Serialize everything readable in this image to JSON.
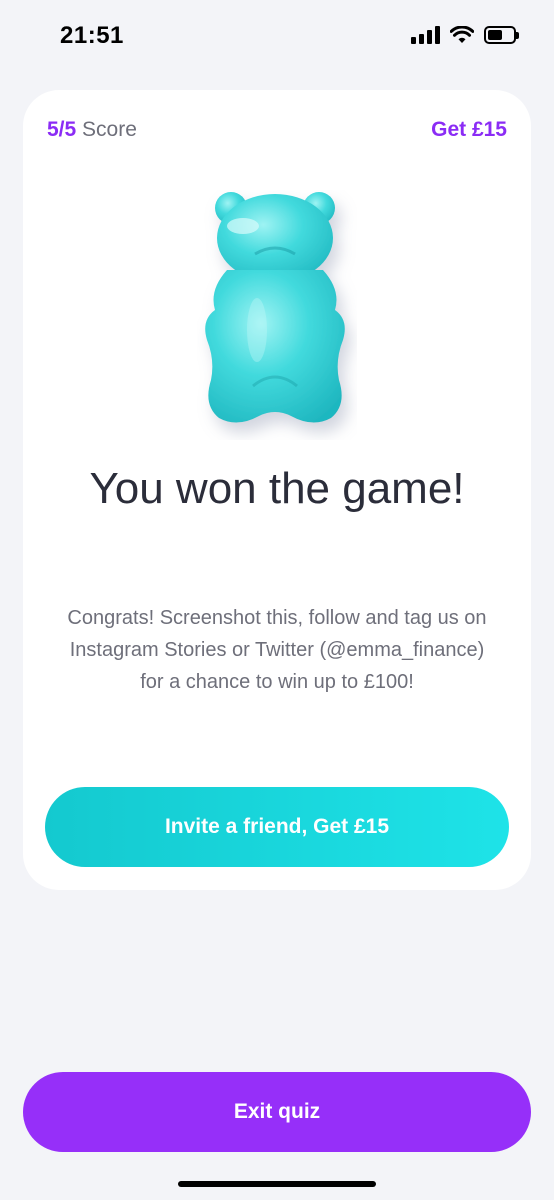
{
  "status_bar": {
    "time": "21:51",
    "icons": [
      "cellular-signal-icon",
      "wifi-icon",
      "battery-icon"
    ]
  },
  "card": {
    "score_value": "5/5",
    "score_label": "Score",
    "reward_link": "Get £15",
    "image": "gummy-bear",
    "title": "You won the game!",
    "body": "Congrats! Screenshot this, follow and tag us on Instagram Stories or Twitter (@emma_finance) for a chance to win up to £100!",
    "invite_button": "Invite a friend, Get £15"
  },
  "footer": {
    "exit_button": "Exit quiz"
  },
  "colors": {
    "accent_purple": "#962ff9",
    "accent_teal": "#1ad6db",
    "background": "#f3f4f8",
    "card": "#ffffff",
    "gummy_bear": "#3fd9dc"
  }
}
